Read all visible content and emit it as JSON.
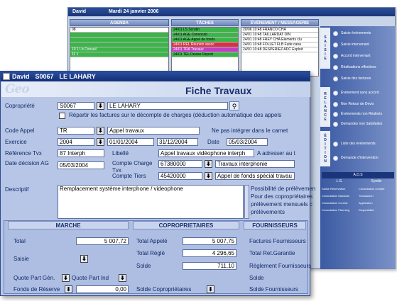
{
  "back_window": {
    "title": "David",
    "date": "Mardi 24 janvier 2006",
    "agenda_label": "AGENDA",
    "taches_label": "TÂCHES",
    "evenement_label": "ÉVÉNEMENT / MESSAGERIE",
    "agenda_rows": [
      "08",
      "",
      "",
      "",
      "10 1 Lb Conseil",
      "11 1",
      "",
      "",
      "",
      "",
      "",
      ""
    ],
    "taches_rows": [
      "24/01 LS Scrutin",
      "24/01 AGE Convocati",
      "24/01 AGE Appel de fonds",
      "24/01 REL Réunion assoc",
      "24/01 TRA Travaux",
      "24/01 TEL Devise Report"
    ],
    "evenement_rows": [
      "20/06 10:48 FRANCO CHA",
      "24/01 10:48 TAILLARDAT DIN",
      "24/01 10:48 FREY CHA Elements clu",
      "24/01 10:48 FOLLET FLB Fuite cana",
      "24/01 10:48 DESPERIEZ ADC Exploit"
    ],
    "side_items": [
      "Saisie événements",
      "Saisie intervenant",
      "Accord intervenant",
      "Réalisations effectives",
      "Saisie des factures",
      "Événement sans accord",
      "Non Retour de Devis",
      "Événements non Réalisés",
      "Demandes non Satisfaites",
      "Liste des événements",
      "Demande d'intervention"
    ],
    "side_bands": [
      "SAISIE",
      "RELANCE",
      "ÉDITION"
    ],
    "ads_label": "A.D.S",
    "ls_label": "L.S.",
    "syndic_label": "Syndic",
    "bottom_items": [
      "Saisie Réservation",
      "Consultation Mandats",
      "Consultation Contrat",
      "Consultation Planning"
    ],
    "right_items": [
      "Consultation compte",
      "Transaction",
      "Application",
      "Disponibilité"
    ]
  },
  "main_window": {
    "user": "David",
    "code": "S0067",
    "name": "LE LAHARY",
    "logo": "Geo",
    "form_title": "Fiche Travaux",
    "copropriete_label": "Copropriété",
    "copropriete_code": "S0067",
    "copropriete_name": "LE LAHARY",
    "repartir_label": "Répartir les factures sur le décompte de charges (déduction automatique des appels",
    "code_appel_label": "Code Appel",
    "code_appel": "TR",
    "code_appel_desc": "Appel travaux",
    "ne_pas_label": "Ne pas intégrer dans le carnet",
    "exercice_label": "Exercice",
    "exercice": "2004",
    "exercice_start": "01/01/2004",
    "exercice_end": "31/12/2004",
    "date_label": "Date",
    "date": "05/03/2004",
    "ref_label": "Référence Tvx",
    "ref_value": "87 Interph",
    "libelle_label": "Libellé",
    "libelle": "Appel travaux vidéophone interph",
    "adresser_label": "A adresser au t",
    "date_decision_label": "Date décision AG",
    "date_decision": "05/03/2004",
    "compte_charge_label": "Compte Charge Tvx",
    "compte_charge": "67380000",
    "compte_charge_desc": "Travaux interphonie",
    "compte_tiers_label": "Compte Tiers",
    "compte_tiers": "45420000",
    "compte_tiers_desc": "Appel de fonds spécial travau",
    "descriptif_label": "Descriptif",
    "descriptif": "Remplacement système interphone / videophone",
    "possibilite_lines": [
      "Possibilité de prélèvemen",
      "Pour des copropriétaires",
      "prélèvement mensuels c",
      "prélèvements"
    ],
    "marche_head": "MARCHE",
    "copro_head": "COPROPRIETAIRES",
    "fourn_head": "FOURNISSEURS",
    "total_label": "Total",
    "total": "5 007,72",
    "saisie_label": "Saisie",
    "quote_gen_label": "Quote Part Gén.",
    "quote_ind_label": "Quote Part Ind",
    "fonds_label": "Fonds de Réserve",
    "fonds": "0,00",
    "total_appele_label": "Total Appelé",
    "total_appele": "5 007,75",
    "total_regle_label": "Total Réglé",
    "total_regle": "4 296,65",
    "solde_label": "Solde",
    "solde": "711,10",
    "solde_copro_label": "Solde Copropriétaires",
    "factures_label": "Factures Fournisseurs",
    "total_ret_label": "Total Ret.Garantie",
    "reglement_label": "Règlement Fournisseurs",
    "solde_f_label": "Solde",
    "solde_fourn_label": "Solde Fournisseurs"
  },
  "colors": {
    "title_bar": "#1a357a",
    "panel": "#b7c6e6",
    "green": "#3cb44a",
    "red": "#d3343f",
    "magenta": "#c13ec4"
  }
}
